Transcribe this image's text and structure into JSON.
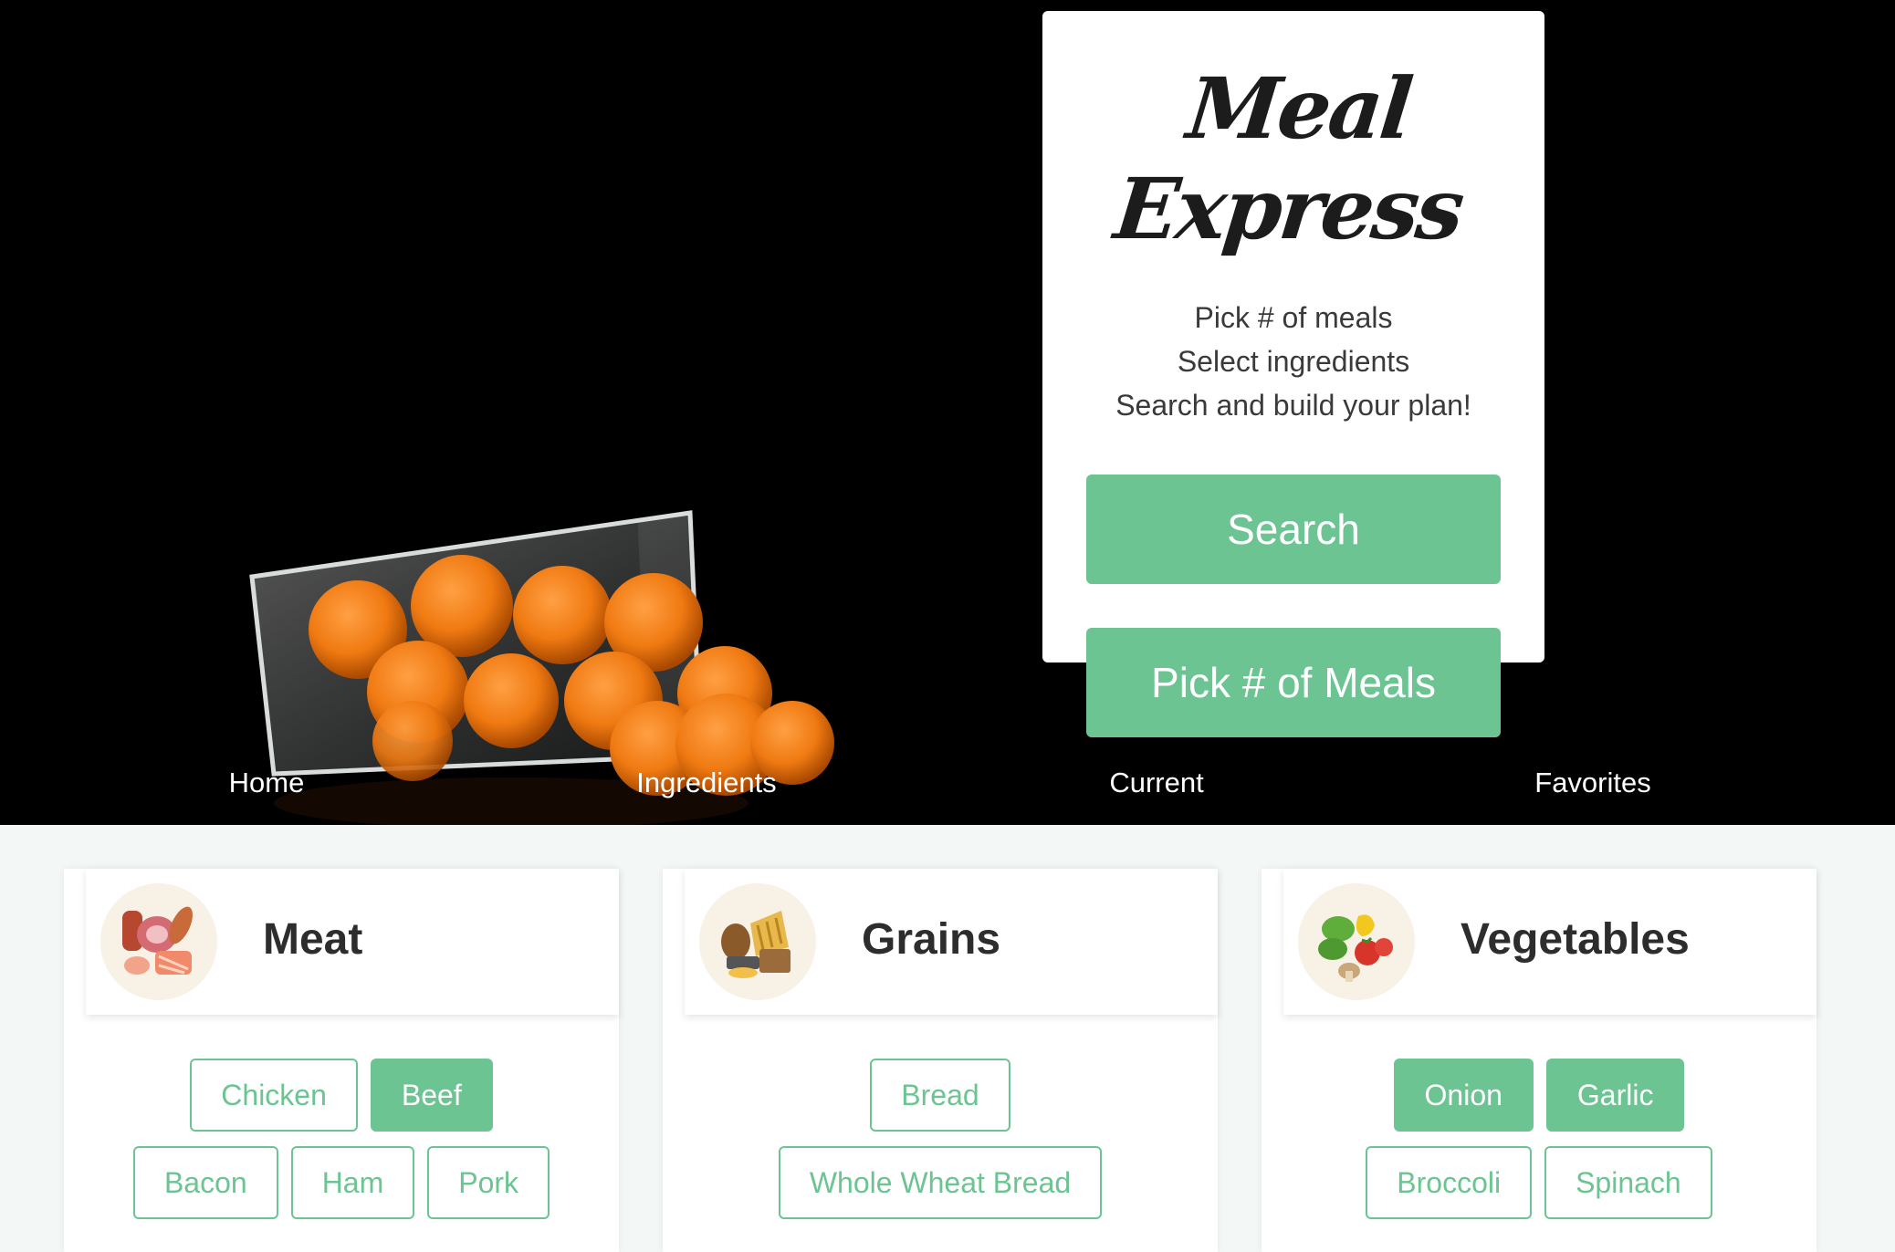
{
  "app": {
    "brand": "Meal Express"
  },
  "intro": {
    "steps": [
      "Pick # of meals",
      "Select ingredients",
      "Search and build your plan!"
    ],
    "search_label": "Search",
    "pick_label": "Pick # of Meals"
  },
  "nav": [
    "Home",
    "Ingredients",
    "Current",
    "Favorites"
  ],
  "categories": [
    {
      "title": "Meat",
      "icon": "meat-icon",
      "rows": [
        [
          {
            "label": "Chicken",
            "selected": false
          },
          {
            "label": "Beef",
            "selected": true
          }
        ],
        [
          {
            "label": "Bacon",
            "selected": false
          },
          {
            "label": "Ham",
            "selected": false
          },
          {
            "label": "Pork",
            "selected": false
          }
        ]
      ]
    },
    {
      "title": "Grains",
      "icon": "bread-icon",
      "rows": [
        [
          {
            "label": "Bread",
            "selected": false
          }
        ],
        [
          {
            "label": "Whole Wheat Bread",
            "selected": false
          }
        ]
      ]
    },
    {
      "title": "Vegetables",
      "icon": "vegetables-icon",
      "rows": [
        [
          {
            "label": "Onion",
            "selected": true
          },
          {
            "label": "Garlic",
            "selected": true
          }
        ],
        [
          {
            "label": "Broccoli",
            "selected": false
          },
          {
            "label": "Spinach",
            "selected": false
          }
        ]
      ]
    }
  ],
  "colors": {
    "accent": "#6cc492",
    "hero_bg": "#000000",
    "page_bg": "#f3f7f5"
  }
}
